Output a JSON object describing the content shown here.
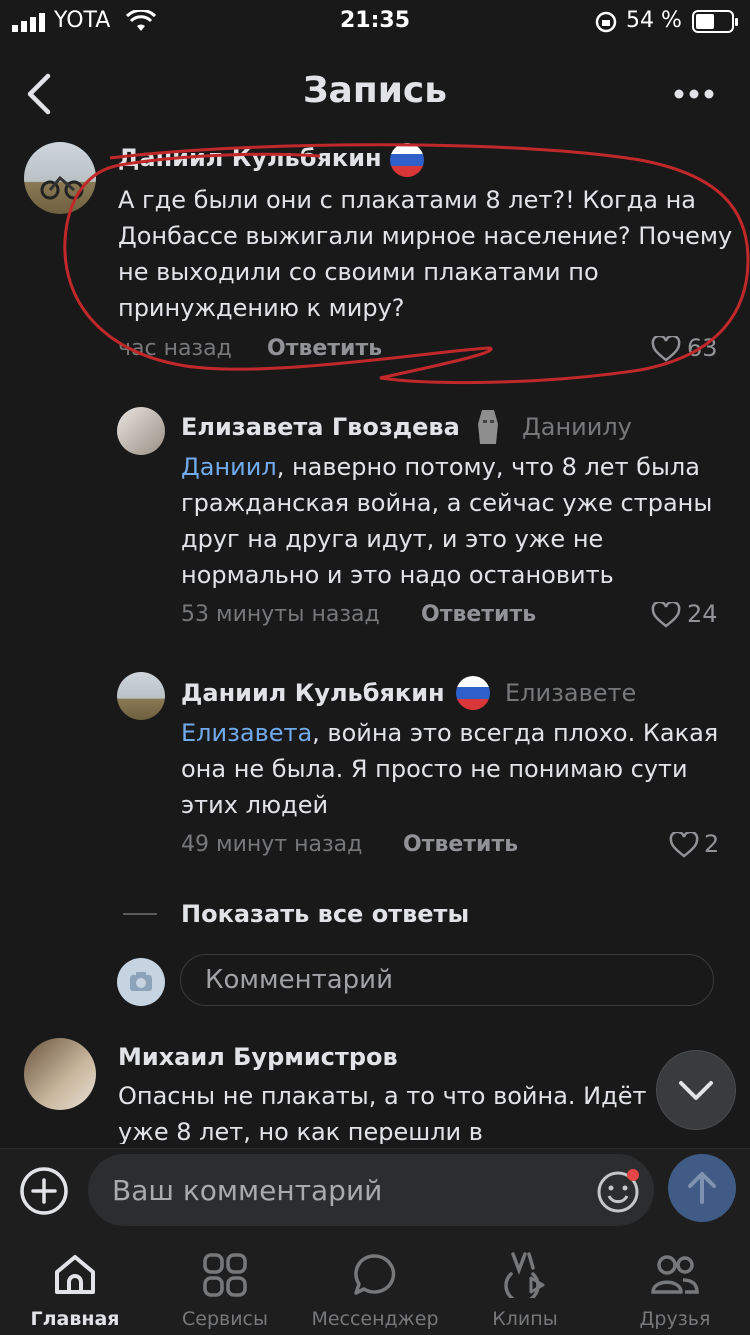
{
  "status_bar": {
    "carrier": "YOTA",
    "time": "21:35",
    "battery": "54 %"
  },
  "header": {
    "title": "Запись"
  },
  "comments": [
    {
      "author": "Даниил Кульбякин",
      "text": "А где были они с плакатами 8 лет?! Когда на Донбассе выжигали мирное население? Почему не выходили со своими плакатами по принуждению к миру?",
      "time": "час назад",
      "reply": "Ответить",
      "likes": "63"
    },
    {
      "author": "Елизавета Гвоздева",
      "to": "Даниилу",
      "mention": "Даниил",
      "text": ", наверно потому, что 8 лет была гражданская война, а сейчас уже страны друг на друга идут, и это уже не нормально и это надо остановить",
      "time": "53 минуты назад",
      "reply": "Ответить",
      "likes": "24"
    },
    {
      "author": "Даниил Кульбякин",
      "to": "Елизавете",
      "mention": "Елизавета",
      "text": ", война это всегда плохо. Какая она не была. Я просто не понимаю сути этих людей",
      "time": "49 минут назад",
      "reply": "Ответить",
      "likes": "2"
    },
    {
      "author": "Михаил Бурмистров",
      "text": "Опасны не плакаты, а то что война. Идёт уже 8 лет, но как перешли в"
    }
  ],
  "show_all": "Показать все ответы",
  "reply_input": {
    "placeholder": "Комментарий"
  },
  "composer": {
    "placeholder": "Ваш комментарий"
  },
  "tabs": [
    {
      "label": "Главная",
      "icon": "home-icon",
      "active": true
    },
    {
      "label": "Сервисы",
      "icon": "services-icon"
    },
    {
      "label": "Мессенджер",
      "icon": "messenger-icon"
    },
    {
      "label": "Клипы",
      "icon": "clips-icon"
    },
    {
      "label": "Друзья",
      "icon": "friends-icon"
    }
  ]
}
